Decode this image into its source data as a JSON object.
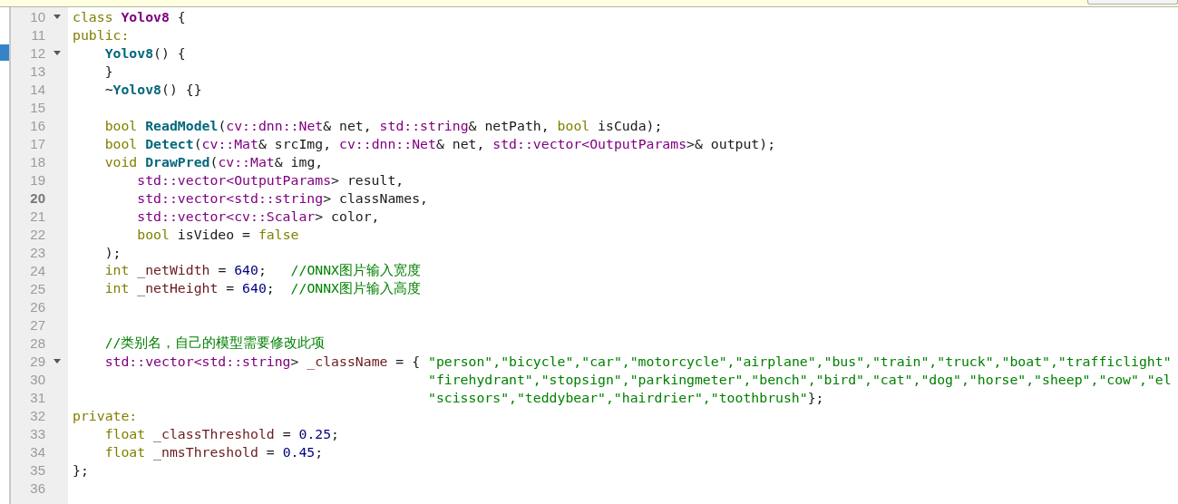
{
  "notification_bar": {
    "shown": true
  },
  "lines": [
    {
      "number": "10",
      "foldable": true,
      "current": false,
      "marked": false,
      "tokens": [
        {
          "kind": "keyword",
          "text": "class "
        },
        {
          "kind": "class",
          "text": "Yolov8"
        },
        {
          "kind": "plain",
          "text": " {"
        }
      ]
    },
    {
      "number": "11",
      "foldable": false,
      "current": false,
      "marked": false,
      "tokens": [
        {
          "kind": "keyword",
          "text": "public:"
        }
      ]
    },
    {
      "number": "12",
      "foldable": true,
      "current": false,
      "marked": true,
      "tokens": [
        {
          "kind": "function",
          "text": "    Yolov8"
        },
        {
          "kind": "plain",
          "text": "() {"
        }
      ]
    },
    {
      "number": "13",
      "foldable": false,
      "current": false,
      "marked": false,
      "tokens": [
        {
          "kind": "plain",
          "text": "    }"
        }
      ]
    },
    {
      "number": "14",
      "foldable": false,
      "current": false,
      "marked": false,
      "tokens": [
        {
          "kind": "plain",
          "text": "    ~"
        },
        {
          "kind": "function",
          "text": "Yolov8"
        },
        {
          "kind": "plain",
          "text": "() {}"
        }
      ]
    },
    {
      "number": "15",
      "foldable": false,
      "current": false,
      "marked": false
    },
    {
      "number": "16",
      "foldable": false,
      "current": false,
      "marked": false,
      "tokens": [
        {
          "kind": "keyword",
          "text": "    bool "
        },
        {
          "kind": "function",
          "text": "ReadModel"
        },
        {
          "kind": "plain",
          "text": "("
        },
        {
          "kind": "type",
          "text": "cv::dnn::Net"
        },
        {
          "kind": "plain",
          "text": "& net, "
        },
        {
          "kind": "type",
          "text": "std::string"
        },
        {
          "kind": "plain",
          "text": "& netPath, "
        },
        {
          "kind": "keyword",
          "text": "bool"
        },
        {
          "kind": "plain",
          "text": " isCuda);"
        }
      ]
    },
    {
      "number": "17",
      "foldable": false,
      "current": false,
      "marked": false,
      "tokens": [
        {
          "kind": "keyword",
          "text": "    bool "
        },
        {
          "kind": "function",
          "text": "Detect"
        },
        {
          "kind": "plain",
          "text": "("
        },
        {
          "kind": "type",
          "text": "cv::Mat"
        },
        {
          "kind": "plain",
          "text": "& srcImg, "
        },
        {
          "kind": "type",
          "text": "cv::dnn::Net"
        },
        {
          "kind": "plain",
          "text": "& net, "
        },
        {
          "kind": "type",
          "text": "std::vector<OutputParams"
        },
        {
          "kind": "plain",
          "text": ">& output);"
        }
      ]
    },
    {
      "number": "18",
      "foldable": false,
      "current": false,
      "marked": false,
      "tokens": [
        {
          "kind": "keyword",
          "text": "    void "
        },
        {
          "kind": "function",
          "text": "DrawPred"
        },
        {
          "kind": "plain",
          "text": "("
        },
        {
          "kind": "type",
          "text": "cv::Mat"
        },
        {
          "kind": "plain",
          "text": "& img,"
        }
      ]
    },
    {
      "number": "19",
      "foldable": false,
      "current": false,
      "marked": false,
      "tokens": [
        {
          "kind": "type",
          "text": "        std::vector<OutputParams"
        },
        {
          "kind": "plain",
          "text": "> result,"
        }
      ]
    },
    {
      "number": "20",
      "foldable": false,
      "current": true,
      "marked": false,
      "tokens": [
        {
          "kind": "type",
          "text": "        std::vector<std::string"
        },
        {
          "kind": "plain",
          "text": "> classNames,"
        }
      ]
    },
    {
      "number": "21",
      "foldable": false,
      "current": false,
      "marked": false,
      "tokens": [
        {
          "kind": "type",
          "text": "        std::vector<cv::Scalar"
        },
        {
          "kind": "plain",
          "text": "> color,"
        }
      ]
    },
    {
      "number": "22",
      "foldable": false,
      "current": false,
      "marked": false,
      "tokens": [
        {
          "kind": "keyword",
          "text": "        bool"
        },
        {
          "kind": "plain",
          "text": " isVideo = "
        },
        {
          "kind": "keyword",
          "text": "false"
        }
      ]
    },
    {
      "number": "23",
      "foldable": false,
      "current": false,
      "marked": false,
      "tokens": [
        {
          "kind": "plain",
          "text": "    );"
        }
      ]
    },
    {
      "number": "24",
      "foldable": false,
      "current": false,
      "marked": false,
      "tokens": [
        {
          "kind": "keyword",
          "text": "    int "
        },
        {
          "kind": "member",
          "text": "_netWidth"
        },
        {
          "kind": "plain",
          "text": " = "
        },
        {
          "kind": "number",
          "text": "640"
        },
        {
          "kind": "plain",
          "text": ";   "
        },
        {
          "kind": "comment",
          "text": "//ONNX图片输入宽度"
        }
      ]
    },
    {
      "number": "25",
      "foldable": false,
      "current": false,
      "marked": false,
      "tokens": [
        {
          "kind": "keyword",
          "text": "    int "
        },
        {
          "kind": "member",
          "text": "_netHeight"
        },
        {
          "kind": "plain",
          "text": " = "
        },
        {
          "kind": "number",
          "text": "640"
        },
        {
          "kind": "plain",
          "text": ";  "
        },
        {
          "kind": "comment",
          "text": "//ONNX图片输入高度"
        }
      ]
    },
    {
      "number": "26",
      "foldable": false,
      "current": false,
      "marked": false
    },
    {
      "number": "27",
      "foldable": false,
      "current": false,
      "marked": false
    },
    {
      "number": "28",
      "foldable": false,
      "current": false,
      "marked": false,
      "tokens": [
        {
          "kind": "comment",
          "text": "    //类别名，自己的模型需要修改此项"
        }
      ]
    },
    {
      "number": "29",
      "foldable": true,
      "current": false,
      "marked": false,
      "tokens": [
        {
          "kind": "type",
          "text": "    std::vector<std::string"
        },
        {
          "kind": "plain",
          "text": "> "
        },
        {
          "kind": "member",
          "text": "_className"
        },
        {
          "kind": "plain",
          "text": " = { "
        },
        {
          "kind": "string",
          "text": "\"person\",\"bicycle\",\"car\",\"motorcycle\",\"airplane\",\"bus\",\"train\",\"truck\",\"boat\",\"trafficlight\""
        }
      ]
    },
    {
      "number": "30",
      "foldable": false,
      "current": false,
      "marked": false,
      "tokens": [
        {
          "kind": "string",
          "text": "                                            \"firehydrant\",\"stopsign\",\"parkingmeter\",\"bench\",\"bird\",\"cat\",\"dog\",\"horse\",\"sheep\",\"cow\",\"el"
        }
      ]
    },
    {
      "number": "31",
      "foldable": false,
      "current": false,
      "marked": false,
      "tokens": [
        {
          "kind": "string",
          "text": "                                            \"scissors\",\"teddybear\",\"hairdrier\",\"toothbrush\""
        },
        {
          "kind": "plain",
          "text": "};"
        }
      ]
    },
    {
      "number": "32",
      "foldable": false,
      "current": false,
      "marked": false,
      "tokens": [
        {
          "kind": "keyword",
          "text": "private:"
        }
      ]
    },
    {
      "number": "33",
      "foldable": false,
      "current": false,
      "marked": false,
      "tokens": [
        {
          "kind": "keyword",
          "text": "    float "
        },
        {
          "kind": "member",
          "text": "_classThreshold"
        },
        {
          "kind": "plain",
          "text": " = "
        },
        {
          "kind": "number",
          "text": "0.25"
        },
        {
          "kind": "plain",
          "text": ";"
        }
      ]
    },
    {
      "number": "34",
      "foldable": false,
      "current": false,
      "marked": false,
      "tokens": [
        {
          "kind": "keyword",
          "text": "    float "
        },
        {
          "kind": "member",
          "text": "_nmsThreshold"
        },
        {
          "kind": "plain",
          "text": " = "
        },
        {
          "kind": "number",
          "text": "0.45"
        },
        {
          "kind": "plain",
          "text": ";"
        }
      ]
    },
    {
      "number": "35",
      "foldable": false,
      "current": false,
      "marked": false,
      "tokens": [
        {
          "kind": "plain",
          "text": "};"
        }
      ]
    },
    {
      "number": "36",
      "foldable": false,
      "current": false,
      "marked": false
    }
  ]
}
